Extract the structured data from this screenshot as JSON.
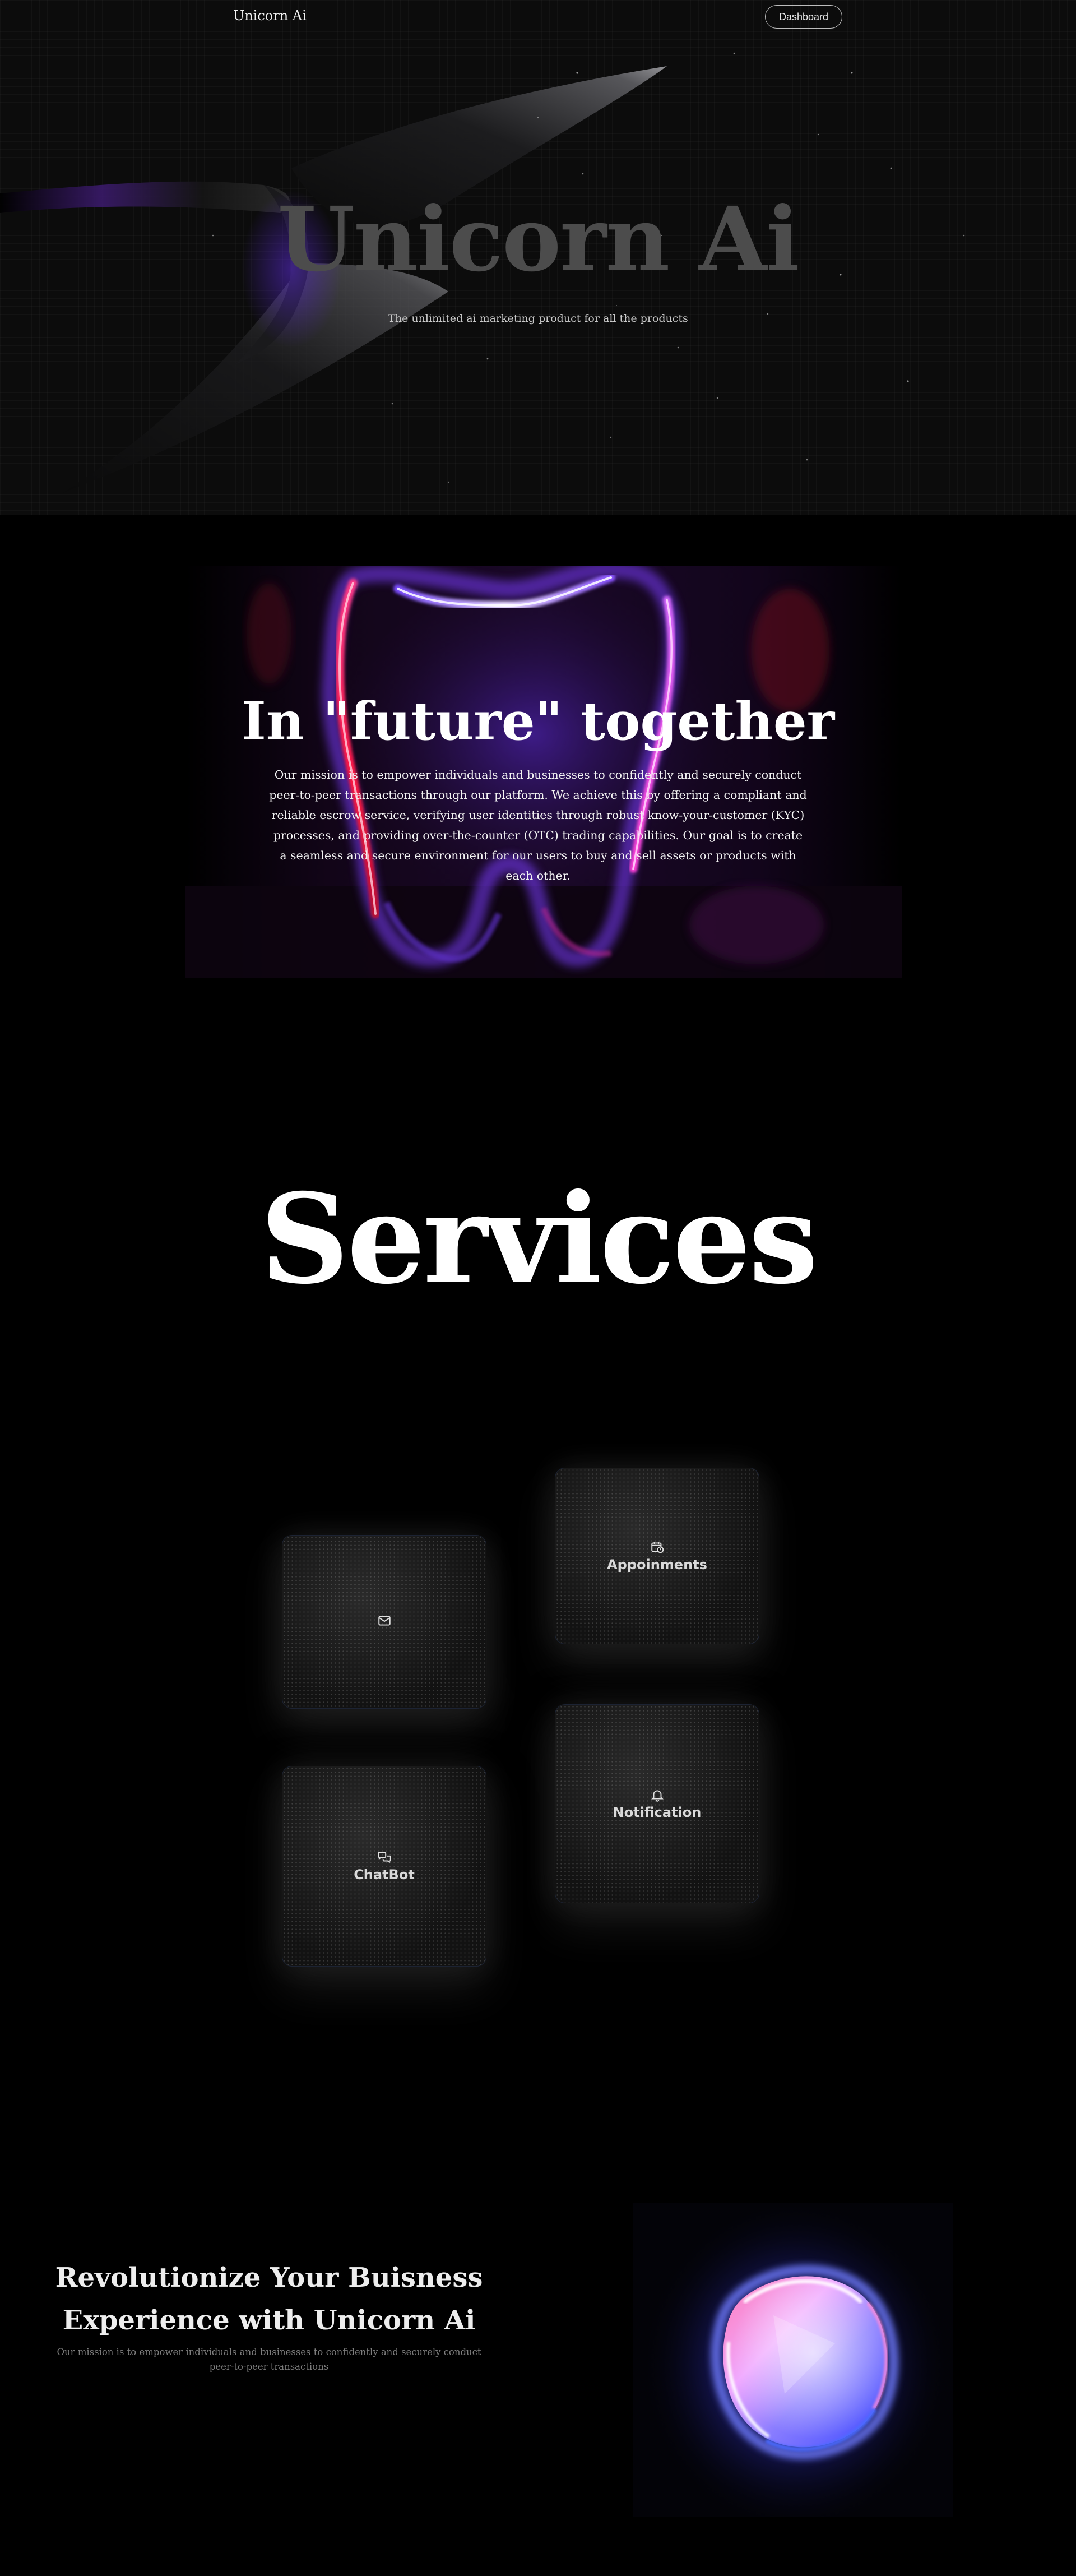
{
  "nav": {
    "brand": "Unicorn Ai",
    "dashboard_label": "Dashboard"
  },
  "hero": {
    "title": "Unicorn Ai",
    "subtitle": "The unlimited ai marketing product for all the products"
  },
  "mission": {
    "title": "In \"future\" together",
    "text": "Our mission is to empower individuals and businesses to confidently and securely conduct peer-to-peer transactions through our platform. We achieve this by offering a compliant and reliable escrow service, verifying user identities through robust know-your-customer (KYC) processes, and providing over-the-counter (OTC) trading capabilities. Our goal is to create a seamless and secure environment for our users to buy and sell assets or products with each other."
  },
  "services": {
    "title": "Services",
    "cards": [
      {
        "label": "",
        "icon": "mail-icon"
      },
      {
        "label": "Appoinments",
        "icon": "calendar-clock-icon"
      },
      {
        "label": "Notification",
        "icon": "bell-icon"
      },
      {
        "label": "ChatBot",
        "icon": "chat-bubbles-icon"
      }
    ]
  },
  "revolution": {
    "title_line1": "Revolutionize Your Buisness",
    "title_line2": "Experience with Unicorn Ai",
    "text": "Our mission is to empower individuals and businesses to confidently and securely conduct peer-to-peer transactions"
  },
  "colors": {
    "background": "#000000",
    "hero_background": "#0c0c0c",
    "hero_title": "#4c4c4c",
    "accent_purple": "#7b3cff",
    "accent_magenta": "#ff2fd0",
    "accent_red": "#ff1e4a",
    "orb_blue": "#2a4bff"
  }
}
